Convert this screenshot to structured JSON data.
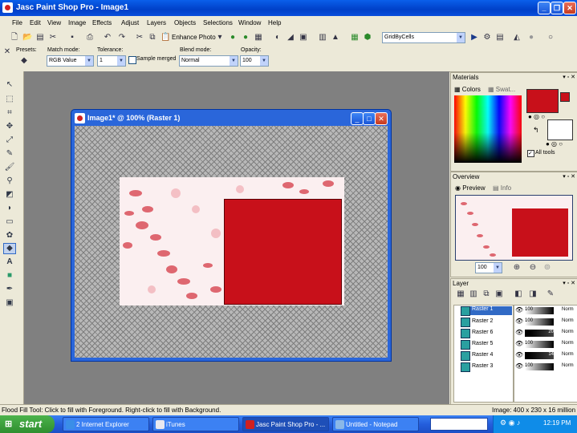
{
  "app": {
    "title": "Jasc Paint Shop Pro - Image1"
  },
  "menu": [
    "File",
    "Edit",
    "View",
    "Image",
    "Effects",
    "Adjust",
    "Layers",
    "Objects",
    "Selections",
    "Window",
    "Help"
  ],
  "toolbar1": {
    "enhance_photo": "Enhance Photo",
    "script": "GridByCells"
  },
  "toolbar2": {
    "presets_label": "Presets:",
    "match_mode_label": "Match mode:",
    "match_mode_value": "RGB Value",
    "tolerance_label": "Tolerance:",
    "tolerance_value": "1",
    "sample_merged_label": "Sample merged",
    "blend_mode_label": "Blend mode:",
    "blend_mode_value": "Normal",
    "opacity_label": "Opacity:",
    "opacity_value": "100"
  },
  "image_window": {
    "title": "Image1* @ 100% (Raster 1)"
  },
  "materials": {
    "title": "Materials",
    "tab_colors": "Colors",
    "tab_swatches": "Swat...",
    "all_tools": "All tools",
    "foreground_color": "#C8101A",
    "background_color": "#FFFFFF"
  },
  "overview": {
    "title": "Overview",
    "tab_preview": "Preview",
    "tab_info": "Info",
    "zoom": "100"
  },
  "layers": {
    "title": "Layer",
    "rows": [
      {
        "name": "Raster 1",
        "opacity": "100",
        "blend": "Norm",
        "selected": true
      },
      {
        "name": "Raster 2",
        "opacity": "100",
        "blend": "Norm"
      },
      {
        "name": "Raster 6",
        "opacity": "20",
        "blend": "Norm"
      },
      {
        "name": "Raster 5",
        "opacity": "100",
        "blend": "Norm"
      },
      {
        "name": "Raster 4",
        "opacity": "14",
        "blend": "Norm"
      },
      {
        "name": "Raster 3",
        "opacity": "100",
        "blend": "Norm"
      }
    ]
  },
  "status": {
    "left": "Flood Fill Tool: Click to fill with Foreground. Right-click to fill with Background.",
    "right": "Image:  400 x 230 x 16 million"
  },
  "taskbar": {
    "start": "start",
    "tasks": [
      "2 Internet Explorer",
      "iTunes",
      "Jasc Paint Shop Pro - ...",
      "Untitled - Notepad"
    ],
    "clock": "12:19 PM"
  }
}
